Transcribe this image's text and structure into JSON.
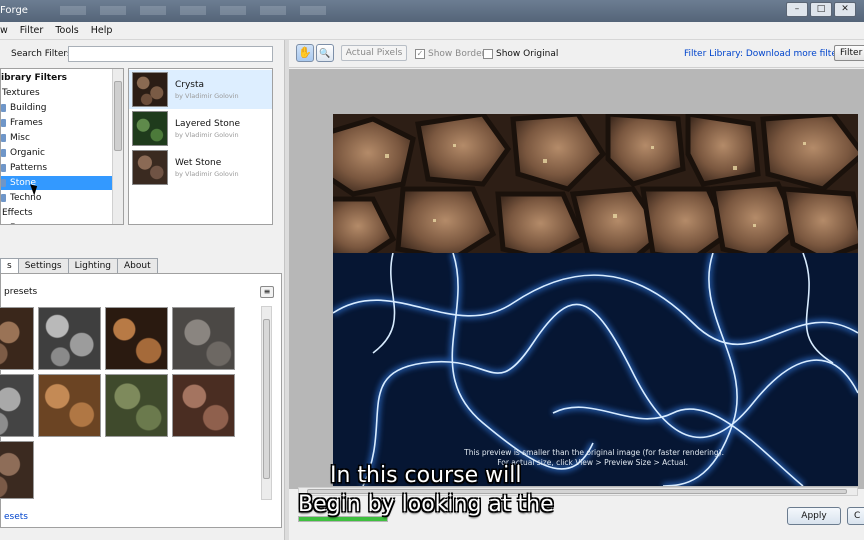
{
  "window": {
    "title": "Forge"
  },
  "menu": [
    "w",
    "Filter",
    "Tools",
    "Help"
  ],
  "search": {
    "label": "Search Filters:",
    "value": ""
  },
  "tree": {
    "items": [
      {
        "label": "ibrary Filters",
        "indent": 0,
        "bold": true
      },
      {
        "label": "Textures",
        "indent": 1
      },
      {
        "label": "Building",
        "indent": 2
      },
      {
        "label": "Frames",
        "indent": 2
      },
      {
        "label": "Misc",
        "indent": 2
      },
      {
        "label": "Organic",
        "indent": 2
      },
      {
        "label": "Patterns",
        "indent": 2
      },
      {
        "label": "Stone",
        "indent": 2,
        "selected": true
      },
      {
        "label": "Techno",
        "indent": 2
      },
      {
        "label": "Effects",
        "indent": 1
      },
      {
        "label": "Frame",
        "indent": 2
      }
    ]
  },
  "filters": [
    {
      "name": "Crysta",
      "author": "by Vladimir Golovin",
      "selected": true
    },
    {
      "name": "Layered Stone",
      "author": "by Vladimir Golovin"
    },
    {
      "name": "Wet Stone",
      "author": "by Vladimir Golovin"
    }
  ],
  "tabs": [
    {
      "label": "s",
      "active": true
    },
    {
      "label": "Settings"
    },
    {
      "label": "Lighting"
    },
    {
      "label": "About"
    }
  ],
  "presets": {
    "header": "presets",
    "link": "esets",
    "menu_icon": "≡"
  },
  "toolbar": {
    "hand_icon": "✋",
    "zoom_icon": "🔍",
    "actual_pixels": "Actual Pixels",
    "show_border": "Show Border",
    "show_border_checked": true,
    "show_original": "Show Original",
    "show_original_checked": false,
    "library_link": "Filter Library: Download more filters",
    "filter_button": "Filter L"
  },
  "preview": {
    "note_line1": "This preview is smaller than the original image (for faster rendering).",
    "note_line2": "For actual size, click View > Preview Size > Actual."
  },
  "progress": 1.0,
  "buttons": {
    "apply": "Apply",
    "cancel": "C"
  },
  "captions": [
    "In this course will",
    "Begin by looking at the"
  ],
  "colors": {
    "selection": "#3399ff",
    "link": "#0044cc",
    "progress": "#3fbf3f"
  }
}
